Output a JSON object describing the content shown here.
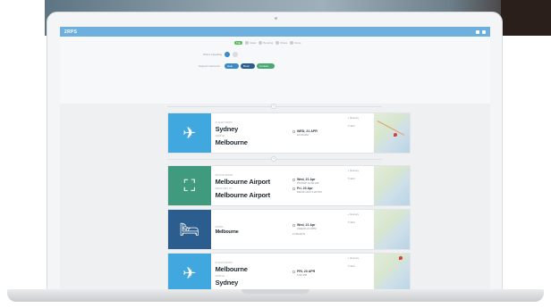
{
  "app": {
    "brand": "2RPS"
  },
  "steps": [
    {
      "label": "Trip",
      "active": true
    },
    {
      "label": "Ideas",
      "active": false
    },
    {
      "label": "Booking",
      "active": false
    },
    {
      "label": "Share",
      "active": false
    },
    {
      "label": "Done",
      "active": false
    }
  ],
  "who": {
    "label": "Who's travelling"
  },
  "support": {
    "label": "Support centre for",
    "chips": [
      "Help",
      "Book",
      "Contact"
    ]
  },
  "cards": [
    {
      "type": "flight",
      "icon": "✈",
      "color": "#41a8df",
      "from_label": "FLIGHT FROM",
      "from": "Sydney",
      "to_label": "ARRIVE",
      "to": "Melbourne",
      "times": [
        {
          "date": "WED, 21 APR",
          "sub": "10:20 AM"
        }
      ],
      "actions": [
        "+ Itinerary",
        "✎ Edit"
      ]
    },
    {
      "type": "car",
      "icon": "⛶",
      "color": "#3f9a7e",
      "from_label": "PICKUP FROM",
      "from": "Melbourne Airport",
      "to_label": "DROP OFF TO",
      "to": "Melbourne Airport",
      "times": [
        {
          "date": "Wed, 21 Apr",
          "sub": "PICKUP 11:00 AM"
        },
        {
          "date": "Fri, 23 Apr",
          "sub": "DROP-OFF 2:20 PM"
        }
      ],
      "actions": [
        "+ Itinerary",
        "✎ Edit"
      ]
    },
    {
      "type": "hotel",
      "icon": "🛏",
      "color": "#2c5d8f",
      "from_label": "HOTEL",
      "from": "",
      "to_label": "",
      "to": "Melbourne",
      "times": [
        {
          "date": "Wed, 21 Apr",
          "sub": "CHECK-IN 2PM"
        },
        {
          "date": "",
          "sub": "2 NIGHTS"
        }
      ],
      "actions": [
        "+ Itinerary",
        "✎ Edit"
      ]
    },
    {
      "type": "flight",
      "icon": "✈",
      "color": "#41a8df",
      "from_label": "FLIGHT FROM",
      "from": "Melbourne",
      "to_label": "ARRIVE",
      "to": "Sydney",
      "times": [
        {
          "date": "FRI, 23 APR",
          "sub": "5:30 PM"
        }
      ],
      "actions": [
        "+ Itinerary",
        "✎ Edit"
      ]
    }
  ]
}
